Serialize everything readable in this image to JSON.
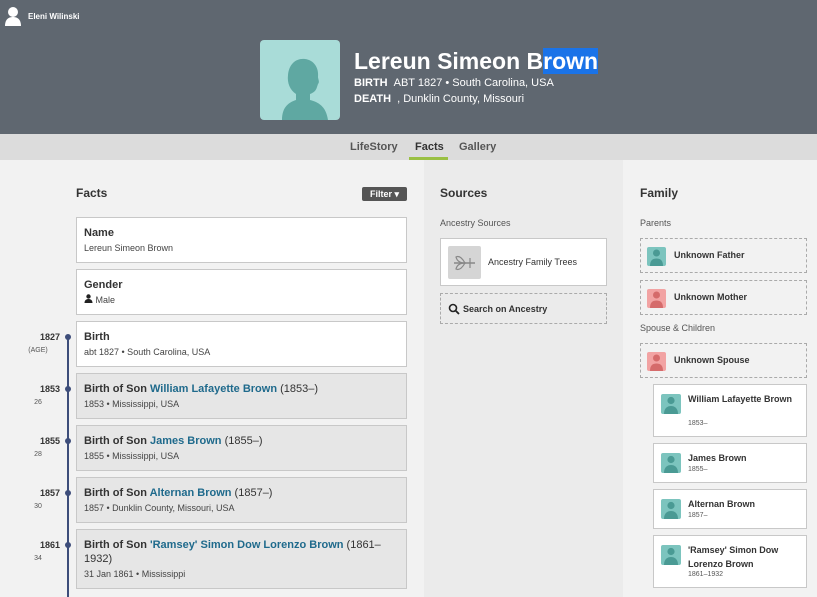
{
  "user": {
    "name": "Eleni Wilinski"
  },
  "person": {
    "name_main": "Lereun Simeon B",
    "name_highlight": "rown",
    "birth_label": "BIRTH",
    "birth_value": "ABT 1827 • South Carolina, USA",
    "death_label": "DEATH",
    "death_value": ", Dunklin County, Missouri"
  },
  "tabs": [
    {
      "label": "LifeStory"
    },
    {
      "label": "Facts"
    },
    {
      "label": "Gallery"
    }
  ],
  "facts": {
    "title": "Facts",
    "filter_label": "Filter",
    "name_card": {
      "title": "Name",
      "detail": "Lereun Simeon Brown"
    },
    "gender_card": {
      "title": "Gender",
      "detail": "Male"
    },
    "events": [
      {
        "year": "1827",
        "age": "(AGE)",
        "title": "Birth",
        "detail": "abt 1827 • South Carolina, USA"
      },
      {
        "year": "1853",
        "age": "26",
        "prefix": "Birth of Son ",
        "link": "William Lafayette Brown",
        "suffix": " (1853–)",
        "detail": "1853 • Mississippi, USA"
      },
      {
        "year": "1855",
        "age": "28",
        "prefix": "Birth of Son ",
        "link": "James Brown",
        "suffix": " (1855–)",
        "detail": "1855 • Mississippi, USA"
      },
      {
        "year": "1857",
        "age": "30",
        "prefix": "Birth of Son ",
        "link": "Alternan Brown",
        "suffix": " (1857–)",
        "detail": "1857 • Dunklin County, Missouri, USA"
      },
      {
        "year": "1861",
        "age": "34",
        "prefix": "Birth of Son ",
        "link": "'Ramsey' Simon Dow Lorenzo Brown",
        "suffix": " (1861–1932)",
        "detail": "31 Jan 1861 • Mississippi"
      }
    ]
  },
  "sources": {
    "title": "Sources",
    "subtitle": "Ancestry Sources",
    "items": [
      {
        "label": "Ancestry Family Trees"
      }
    ],
    "search_label": "Search on Ancestry"
  },
  "family": {
    "title": "Family",
    "parents_label": "Parents",
    "father": "Unknown Father",
    "mother": "Unknown Mother",
    "spouse_label": "Spouse & Children",
    "spouse": "Unknown Spouse",
    "children": [
      {
        "name": "William Lafayette Brown",
        "years": "1853–"
      },
      {
        "name": "James Brown",
        "years": "1855–"
      },
      {
        "name": "Alternan Brown",
        "years": "1857–"
      },
      {
        "name": "'Ramsey' Simon Dow Lorenzo Brown",
        "years": "1861–1932"
      }
    ]
  },
  "colors": {
    "header_bg": "#5f6770",
    "portrait_bg": "#a9dcd8",
    "male_avatar": "#7cc4be",
    "female_avatar": "#f2a3a3",
    "link": "#1f6a8c",
    "timeline": "#3d4d7a",
    "tab_accent": "#9ac043",
    "name_highlight": "#1a73e8"
  }
}
